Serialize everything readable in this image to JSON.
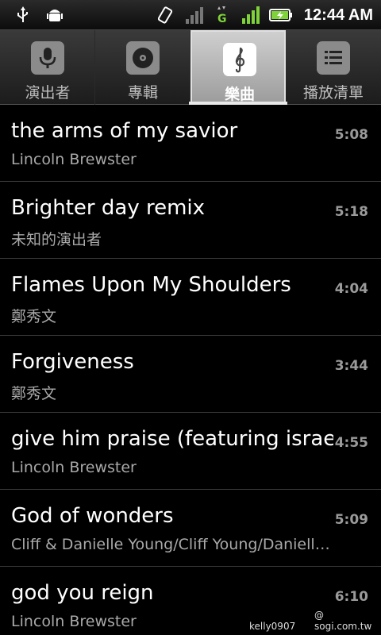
{
  "status_bar": {
    "time": "12:44 AM",
    "icons": [
      "usb-icon",
      "android-debug-icon",
      "rotation-icon",
      "signal-off-icon",
      "data-g-icon",
      "signal-strength-icon",
      "battery-charging-icon"
    ]
  },
  "tabs": [
    {
      "label": "演出者",
      "icon": "microphone-icon",
      "selected": false
    },
    {
      "label": "專輯",
      "icon": "disc-icon",
      "selected": false
    },
    {
      "label": "樂曲",
      "icon": "music-note-icon",
      "selected": true
    },
    {
      "label": "播放清單",
      "icon": "playlist-icon",
      "selected": false
    }
  ],
  "songs": [
    {
      "title": "the arms of my savior",
      "artist": "Lincoln Brewster",
      "duration": "5:08"
    },
    {
      "title": "Brighter day remix",
      "artist": "未知的演出者",
      "duration": "5:18"
    },
    {
      "title": "Flames Upon My Shoulders",
      "artist": "鄭秀文",
      "duration": "4:04"
    },
    {
      "title": "Forgiveness",
      "artist": "鄭秀文",
      "duration": "3:44"
    },
    {
      "title": "give him praise (featuring israel houghton)",
      "artist": "Lincoln Brewster",
      "duration": "4:55"
    },
    {
      "title": "God of wonders",
      "artist": "Cliff & Danielle Young/Cliff Young/Danielle Young",
      "duration": "5:09"
    },
    {
      "title": "god you reign",
      "artist": "Lincoln Brewster",
      "duration": "6:10"
    }
  ],
  "watermark": {
    "left": "kelly0907",
    "right": "@ sogi.com.tw"
  }
}
